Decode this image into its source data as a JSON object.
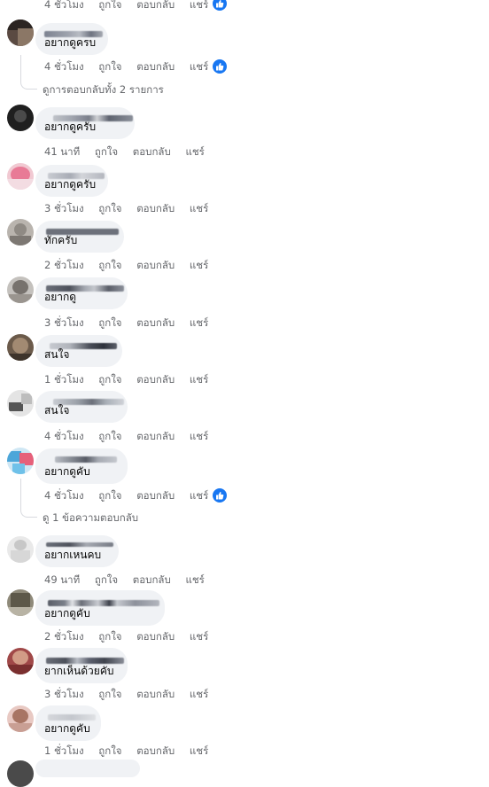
{
  "comments": [
    {
      "text": "",
      "actions": {
        "time": "4 ชั่วโมง",
        "like": "ถูกใจ",
        "reply": "ตอบกลับ",
        "share": "แชร์"
      }
    },
    {
      "text": "อยากดูครบ",
      "actions": {
        "time": "4 ชั่วโมง",
        "like": "ถูกใจ",
        "reply": "ตอบกลับ",
        "share": "แชร์"
      },
      "view_replies": "ดูการตอบกลับทั้ง 2 รายการ"
    },
    {
      "text": "อยากดูครับ",
      "actions": {
        "time": "41 นาที",
        "like": "ถูกใจ",
        "reply": "ตอบกลับ",
        "share": "แชร์"
      }
    },
    {
      "text": "อยากดูครับ",
      "actions": {
        "time": "3 ชั่วโมง",
        "like": "ถูกใจ",
        "reply": "ตอบกลับ",
        "share": "แชร์"
      }
    },
    {
      "text": "ทักครับ",
      "actions": {
        "time": "2 ชั่วโมง",
        "like": "ถูกใจ",
        "reply": "ตอบกลับ",
        "share": "แชร์"
      }
    },
    {
      "text": "อยากดู",
      "actions": {
        "time": "3 ชั่วโมง",
        "like": "ถูกใจ",
        "reply": "ตอบกลับ",
        "share": "แชร์"
      }
    },
    {
      "text": "สนใจ",
      "actions": {
        "time": "1 ชั่วโมง",
        "like": "ถูกใจ",
        "reply": "ตอบกลับ",
        "share": "แชร์"
      }
    },
    {
      "text": "สนใจ",
      "actions": {
        "time": "4 ชั่วโมง",
        "like": "ถูกใจ",
        "reply": "ตอบกลับ",
        "share": "แชร์"
      }
    },
    {
      "text": "อยากดูคับ",
      "actions": {
        "time": "4 ชั่วโมง",
        "like": "ถูกใจ",
        "reply": "ตอบกลับ",
        "share": "แชร์"
      },
      "view_replies": "ดู 1 ข้อความตอบกลับ"
    },
    {
      "text": "อยากเหนคบ",
      "actions": {
        "time": "49 นาที",
        "like": "ถูกใจ",
        "reply": "ตอบกลับ",
        "share": "แชร์"
      }
    },
    {
      "text": "อยากดูคับ",
      "actions": {
        "time": "2 ชั่วโมง",
        "like": "ถูกใจ",
        "reply": "ตอบกลับ",
        "share": "แชร์"
      }
    },
    {
      "text": "ยากเห็นด้วยคับ",
      "actions": {
        "time": "3 ชั่วโมง",
        "like": "ถูกใจ",
        "reply": "ตอบกลับ",
        "share": "แชร์"
      }
    },
    {
      "text": "อยากดูคับ",
      "actions": {
        "time": "1 ชั่วโมง",
        "like": "ถูกใจ",
        "reply": "ตอบกลับ",
        "share": "แชร์"
      }
    }
  ],
  "colors": {
    "bubble": "#f0f2f5",
    "meta_text": "#65676b",
    "like_badge": "#1877f2",
    "thread_line": "#d8dadf"
  },
  "icons": {
    "like_badge": "thumbs-up-icon"
  }
}
